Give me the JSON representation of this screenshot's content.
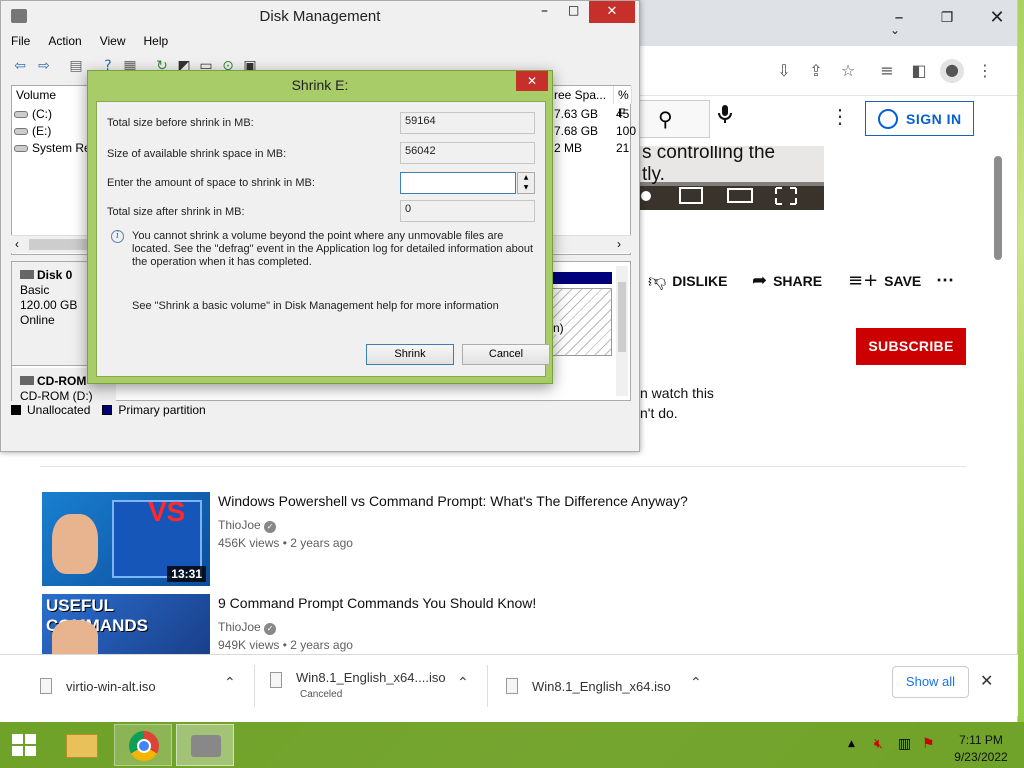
{
  "chrome": {
    "sign_in": "SIGN IN",
    "video_caption": "s controlling the\ntly.",
    "actions": {
      "dislike": "DISLIKE",
      "share": "SHARE",
      "save": "SAVE"
    },
    "subscribe": "SUBSCRIBE",
    "message_line1": "n watch this",
    "message_line2": "n't do.",
    "related": [
      {
        "title": "Windows Powershell vs Command Prompt: What's The Difference Anyway?",
        "channel": "ThioJoe",
        "meta": "456K views • 2 years ago",
        "duration": "13:31",
        "thumb_text": "VS"
      },
      {
        "title": "9 Command Prompt Commands You Should Know!",
        "channel": "ThioJoe",
        "meta": "949K views • 2 years ago",
        "thumb_text": "USEFUL COMMANDS"
      }
    ],
    "downloads": [
      {
        "name": "virtio-win-alt.iso",
        "status": ""
      },
      {
        "name": "Win8.1_English_x64....iso",
        "status": "Canceled"
      },
      {
        "name": "Win8.1_English_x64.iso",
        "status": ""
      }
    ],
    "show_all": "Show all"
  },
  "disk_mgmt": {
    "title": "Disk Management",
    "menu": [
      "File",
      "Action",
      "View",
      "Help"
    ],
    "columns": {
      "volume": "Volume",
      "free_space": "ree Spa...",
      "pct": "% F"
    },
    "volumes": [
      {
        "name": "(C:)",
        "free": "7.63 GB",
        "pct": "45"
      },
      {
        "name": "(E:)",
        "free": "7.68 GB",
        "pct": "100"
      },
      {
        "name": "System Res",
        "free": "2 MB",
        "pct": "21"
      }
    ],
    "disk0": {
      "name": "Disk 0",
      "type": "Basic",
      "size": "120.00 GB",
      "status": "Online"
    },
    "partition_fragment": "n)",
    "cdrom": {
      "name": "CD-ROM",
      "label": "CD-ROM (D:)"
    },
    "legend": {
      "unallocated": "Unallocated",
      "primary": "Primary partition"
    },
    "colors": {
      "unallocated": "#000000",
      "primary": "#00007a"
    }
  },
  "shrink_dialog": {
    "title": "Shrink E:",
    "total_before_label": "Total size before shrink in MB:",
    "total_before": "59164",
    "available_label": "Size of available shrink space in MB:",
    "available": "56042",
    "amount_label": "Enter the amount of space to shrink in MB:",
    "amount": "",
    "total_after_label": "Total size after shrink in MB:",
    "total_after": "0",
    "info": "You cannot shrink a volume beyond the point where any unmovable files are located. See the \"defrag\" event in the Application log for detailed information about the operation when it has completed.",
    "help": "See \"Shrink a basic volume\" in Disk Management help for more information",
    "shrink_button": "Shrink",
    "cancel_button": "Cancel"
  },
  "taskbar": {
    "time": "7:11 PM",
    "date": "9/23/2022"
  }
}
